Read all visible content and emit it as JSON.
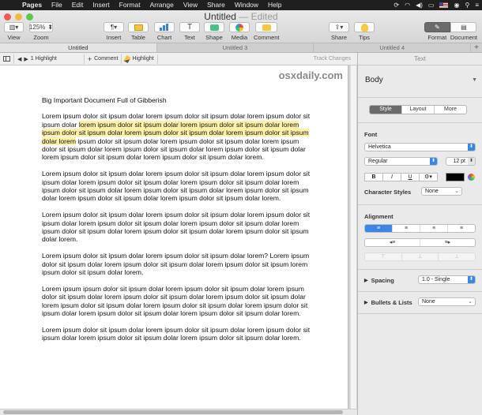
{
  "menubar": {
    "app_name": "Pages",
    "items": [
      "File",
      "Edit",
      "Insert",
      "Format",
      "Arrange",
      "View",
      "Share",
      "Window",
      "Help"
    ]
  },
  "window": {
    "title": "Untitled",
    "title_suffix": "— Edited"
  },
  "toolbar": {
    "view_label": "View",
    "zoom_value": "125%",
    "zoom_label": "Zoom",
    "insert_label": "Insert",
    "table_label": "Table",
    "chart_label": "Chart",
    "text_label": "Text",
    "shape_label": "Shape",
    "media_label": "Media",
    "comment_label": "Comment",
    "share_label": "Share",
    "tips_label": "Tips",
    "format_label": "Format",
    "document_label": "Document"
  },
  "tabs": [
    "Untitled",
    "Untitled 3",
    "Untitled 4"
  ],
  "subbar": {
    "highlight_count": "1 Highlight",
    "comment_label": "Comment",
    "highlight_label": "Highlight",
    "track_changes_label": "Track Changes"
  },
  "document": {
    "watermark": "osxdaily.com",
    "heading": "Big Important Document Full of Gibberish",
    "p1_before": "Lorem ipsum dolor sit ipsum dolar lorem ipsum dolor sit ipsum dolar lorem ipsum dolor sit ipsum dolar ",
    "p1_highlight": "lorem ipsum dolor sit ipsum dolar lorem ipsum dolor sit ipsum dolar lorem ipsum dolor sit ipsum dolar lorem ipsum dolor sit ipsum dolar lorem ipsum dolor sit ipsum dolar lorem",
    "p1_after": " ipsum dolor sit ipsum dolar lorem ipsum dolor sit ipsum dolar lorem ipsum dolor sit ipsum dolar lorem ipsum dolor sit ipsum dolar lorem ipsum dolor sit ipsum dolar lorem ipsum dolor sit ipsum dolar lorem ipsum dolor sit ipsum dolar lorem.",
    "p2": "Lorem ipsum dolor sit ipsum dolar lorem ipsum dolor sit ipsum dolar lorem ipsum dolor sit ipsum dolar lorem ipsum dolor sit ipsum dolar lorem ipsum dolor sit ipsum dolar lorem ipsum dolor sit ipsum dolar lorem ipsum dolor sit ipsum dolar lorem ipsum dolor sit ipsum dolar lorem ipsum dolor sit ipsum dolar lorem ipsum dolor sit ipsum dolar lorem.",
    "p3": "Lorem ipsum dolor sit ipsum dolar lorem ipsum dolor sit ipsum dolar lorem ipsum dolor sit ipsum dolar lorem ipsum dolor sit ipsum dolar lorem ipsum dolor sit ipsum dolar lorem ipsum dolor sit ipsum dolar lorem ipsum dolor sit ipsum dolar lorem ipsum dolor sit ipsum dolar lorem.",
    "p4": "Lorem ipsum dolor sit ipsum dolar lorem ipsum dolor sit ipsum dolar lorem? Lorem ipsum dolor sit ipsum dolar lorem ipsum dolor sit ipsum dolar lorem ipsum dolor sit ipsum lorem ipsum dolor sit ipsum dolar lorem.",
    "p5": "Lorem ipsum ipsum dolor sit ipsum dolar lorem ipsum dolor sit ipsum dolar lorem ipsum dolor sit ipsum dolar lorem ipsum dolor sit ipsum dolar lorem ipsum dolor sit ipsum dolar lorem ipsum dolor sit ipsum dolar lorem ipsum dolor sit ipsum dolar lorem ipsum dolor sit ipsum dolar lorem ipsum dolor sit ipsum dolar lorem ipsum dolor sit ipsum dolar lorem.",
    "p6": "Lorem ipsum dolor sit ipsum dolar lorem ipsum dolor sit ipsum dolar lorem ipsum dolor sit ipsum dolar lorem ipsum dolor sit ipsum dolar lorem ipsum dolor sit ipsum dolar lorem."
  },
  "inspector": {
    "header": "Text",
    "paragraph_style": "Body",
    "tabs": [
      "Style",
      "Layout",
      "More"
    ],
    "font_section": "Font",
    "font_family": "Helvetica",
    "font_style": "Regular",
    "font_size": "12 pt",
    "bold": "B",
    "italic": "I",
    "underline": "U",
    "gear": "⚙▾",
    "text_color": "#000000",
    "character_styles_label": "Character Styles",
    "character_styles_value": "None",
    "alignment_section": "Alignment",
    "spacing_label": "Spacing",
    "spacing_value": "1.0 - Single",
    "bullets_label": "Bullets & Lists",
    "bullets_value": "None"
  },
  "colors": {
    "highlight": "#fff2a8",
    "accent": "#3a86e6",
    "close": "#ee5a52",
    "minimize": "#f6b83b",
    "maximize": "#5ac84a"
  }
}
